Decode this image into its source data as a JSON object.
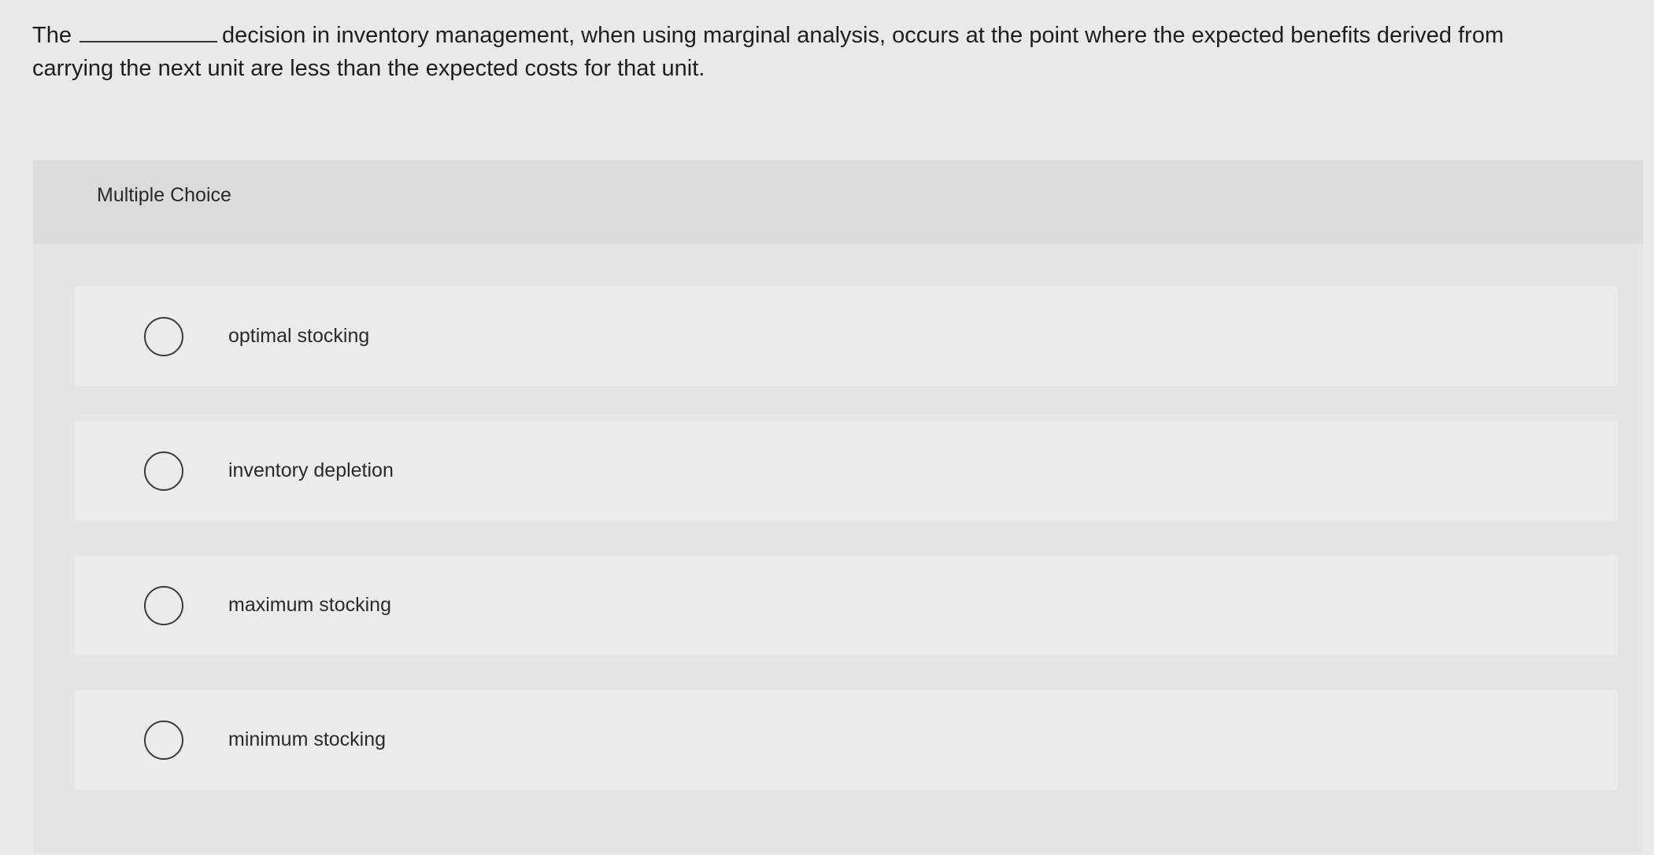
{
  "question": {
    "prefix": "The",
    "suffix": "decision in inventory management, when using marginal analysis, occurs at the point where the expected benefits derived from carrying the next unit are less than the expected costs for that unit."
  },
  "panel": {
    "title": "Multiple Choice"
  },
  "options": [
    {
      "label": "optimal stocking"
    },
    {
      "label": "inventory depletion"
    },
    {
      "label": "maximum stocking"
    },
    {
      "label": "minimum stocking"
    }
  ]
}
